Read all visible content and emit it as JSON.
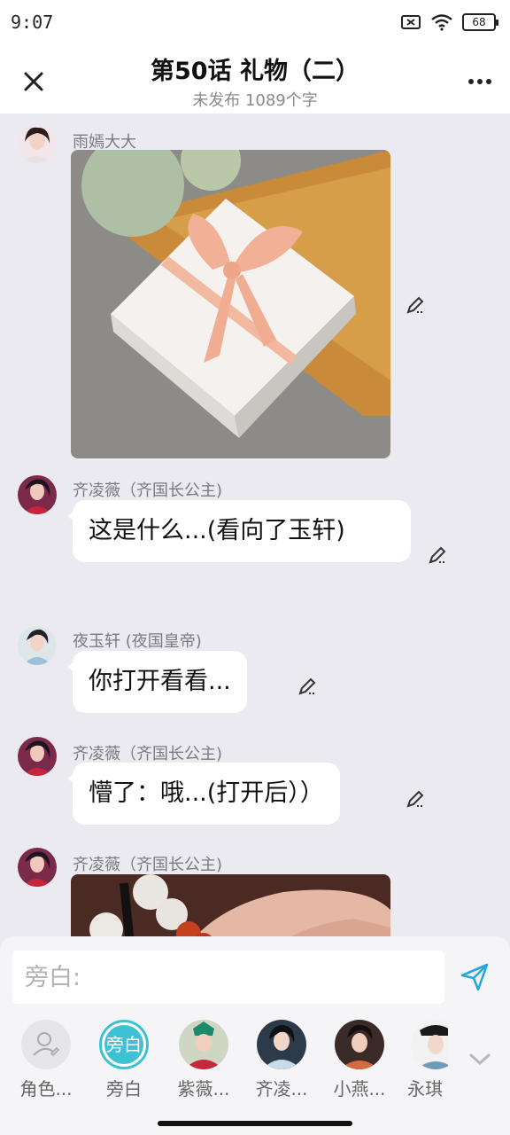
{
  "status": {
    "time": "9:07",
    "battery": "68"
  },
  "header": {
    "title": "第50话 礼物（二）",
    "subtitle": "未发布 1089个字"
  },
  "messages": [
    {
      "sender": "雨嫣大大",
      "type": "image",
      "image_desc": "gift-box"
    },
    {
      "sender": "齐凌薇（齐国长公主)",
      "type": "text",
      "text": "这是什么...(看向了玉轩)"
    },
    {
      "sender": "夜玉轩 (夜国皇帝)",
      "type": "text",
      "text": "你打开看看..."
    },
    {
      "sender": "齐凌薇（齐国长公主)",
      "type": "text",
      "text": "懵了：哦...(打开后））"
    },
    {
      "sender": "齐凌薇（齐国长公主)",
      "type": "image",
      "image_desc": "bead-bracelet"
    }
  ],
  "composer": {
    "placeholder": "旁白:"
  },
  "roles": [
    {
      "label": "角色...",
      "icon": "add-role-icon"
    },
    {
      "label": "旁白",
      "icon": "narration-avatar",
      "selected": true
    },
    {
      "label": "紫薇...",
      "icon": "avatar"
    },
    {
      "label": "齐凌...",
      "icon": "avatar"
    },
    {
      "label": "小燕...",
      "icon": "avatar"
    },
    {
      "label": "永琪",
      "icon": "avatar"
    }
  ],
  "colors": {
    "accent": "#3ec1d3",
    "send": "#2aa7d8",
    "background": "#eaeaf0"
  }
}
